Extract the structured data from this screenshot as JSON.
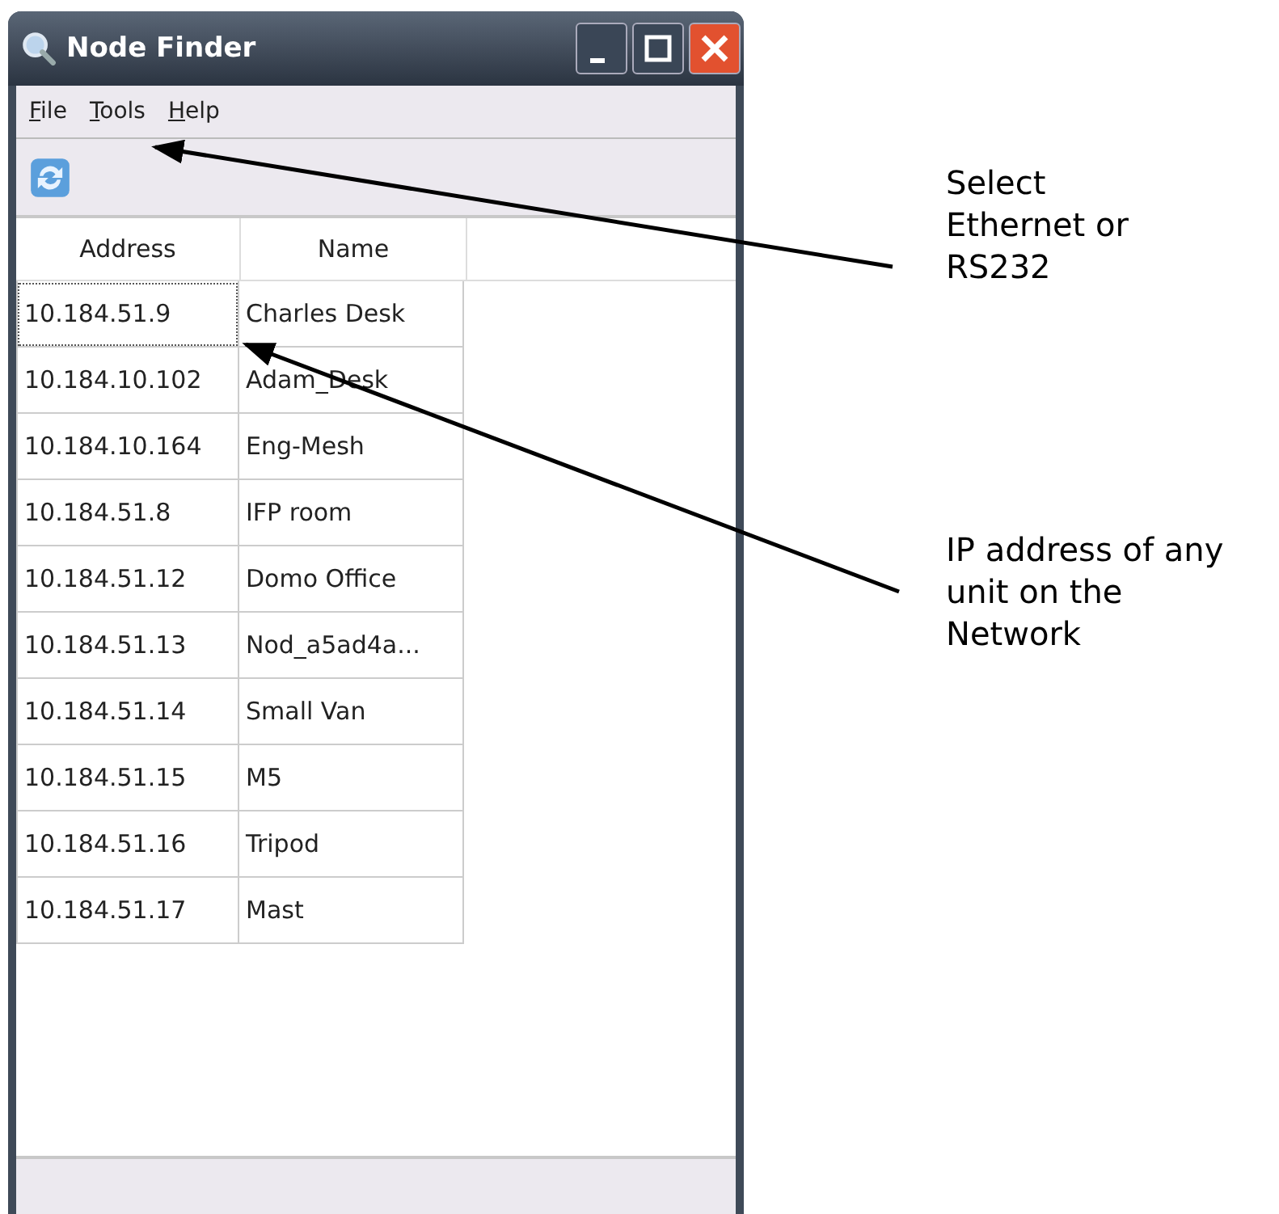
{
  "window": {
    "title": "Node Finder"
  },
  "menu": [
    {
      "label": "File"
    },
    {
      "label": "Tools"
    },
    {
      "label": "Help"
    }
  ],
  "table": {
    "columns": [
      "Address",
      "Name"
    ],
    "rows": [
      {
        "address": "10.184.51.9",
        "name": "Charles Desk",
        "selected": true
      },
      {
        "address": "10.184.10.102",
        "name": "Adam_Desk",
        "selected": false
      },
      {
        "address": "10.184.10.164",
        "name": "Eng-Mesh",
        "selected": false
      },
      {
        "address": "10.184.51.8",
        "name": "IFP room",
        "selected": false
      },
      {
        "address": "10.184.51.12",
        "name": "Domo Office",
        "selected": false
      },
      {
        "address": "10.184.51.13",
        "name": "Nod_a5ad4a...",
        "selected": false
      },
      {
        "address": "10.184.51.14",
        "name": "Small Van",
        "selected": false
      },
      {
        "address": "10.184.51.15",
        "name": "M5",
        "selected": false
      },
      {
        "address": "10.184.51.16",
        "name": "Tripod",
        "selected": false
      },
      {
        "address": "10.184.51.17",
        "name": "Mast",
        "selected": false
      }
    ]
  },
  "annotations": [
    {
      "text": "Select Ethernet or RS232"
    },
    {
      "text": "IP address of any unit on the Network"
    }
  ]
}
